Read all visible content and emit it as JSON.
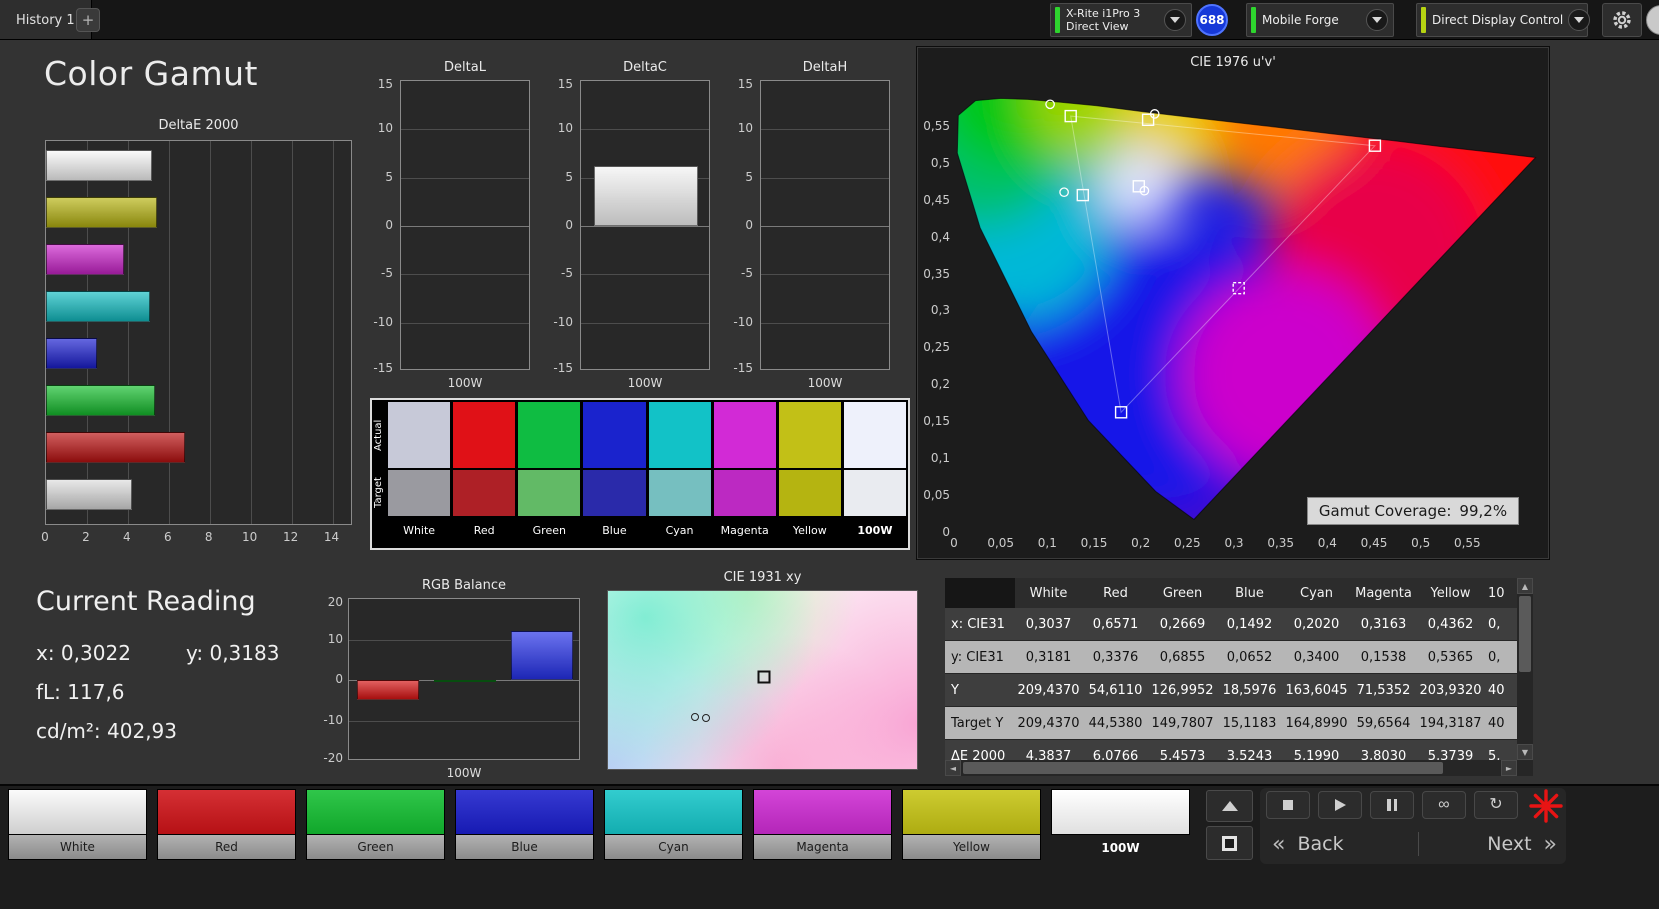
{
  "topbar": {
    "history_tab": "History 1",
    "add_tab": "+",
    "meter": {
      "name": "X-Rite i1Pro 3",
      "mode": "Direct View",
      "badge": "688"
    },
    "pattern_source": "Mobile Forge",
    "display_control": "Direct Display Control"
  },
  "page_title": "Color Gamut",
  "chart_data": [
    {
      "id": "delta_e_2000",
      "type": "bar",
      "title": "DeltaE 2000",
      "orientation": "horizontal",
      "categories": [
        "White",
        "Yellow",
        "Magenta",
        "Cyan",
        "Blue",
        "Green",
        "Red",
        "100W"
      ],
      "values": [
        5.2,
        5.4,
        3.8,
        5.1,
        2.5,
        5.3,
        6.8,
        4.2
      ],
      "bar_colors": [
        "#f8f8f8",
        "#b7b412",
        "#cb24cb",
        "#13bdc2",
        "#1b1fd0",
        "#16be2e",
        "#bb1212",
        "#dedede"
      ],
      "xlim": [
        0,
        15
      ],
      "xticks": [
        0,
        2,
        4,
        6,
        8,
        10,
        12,
        14
      ],
      "grid": true
    },
    {
      "id": "delta_l",
      "type": "bar",
      "title": "DeltaL",
      "categories": [
        "100W"
      ],
      "values": [
        0
      ],
      "ylim": [
        -15,
        15
      ],
      "yticks": [
        15,
        10,
        5,
        0,
        -5,
        -10,
        -15
      ],
      "xlabel": "100W"
    },
    {
      "id": "delta_c",
      "type": "bar",
      "title": "DeltaC",
      "categories": [
        "100W"
      ],
      "values": [
        6.2
      ],
      "bar_colors": [
        "#f2f2f2"
      ],
      "ylim": [
        -15,
        15
      ],
      "yticks": [
        15,
        10,
        5,
        0,
        -5,
        -10,
        -15
      ],
      "xlabel": "100W"
    },
    {
      "id": "delta_h",
      "type": "bar",
      "title": "DeltaH",
      "categories": [
        "100W"
      ],
      "values": [
        0
      ],
      "ylim": [
        -15,
        15
      ],
      "yticks": [
        15,
        10,
        5,
        0,
        -5,
        -10,
        -15
      ],
      "xlabel": "100W"
    },
    {
      "id": "rgb_balance",
      "type": "bar",
      "title": "RGB Balance",
      "categories": [
        "Red",
        "Green",
        "Blue"
      ],
      "values": [
        -5,
        -0.4,
        12
      ],
      "bar_colors": [
        "#d51414",
        "#11aa22",
        "#2531e8"
      ],
      "ylim": [
        -20,
        20
      ],
      "yticks": [
        20,
        10,
        0,
        -10,
        -20
      ],
      "xlabel": "100W"
    },
    {
      "id": "cie1976",
      "type": "scatter",
      "title": "CIE 1976 u'v'",
      "xlim": [
        0,
        0.63
      ],
      "ylim": [
        0,
        0.62
      ],
      "xticks": [
        "0",
        "0,05",
        "0,1",
        "0,15",
        "0,2",
        "0,25",
        "0,3",
        "0,35",
        "0,4",
        "0,45",
        "0,5",
        "0,55"
      ],
      "yticks": [
        "0",
        "0,05",
        "0,1",
        "0,15",
        "0,2",
        "0,25",
        "0,3",
        "0,35",
        "0,4",
        "0,45",
        "0,5",
        "0,55"
      ],
      "annotation": {
        "label": "Gamut Coverage:",
        "value": "99,2%"
      },
      "markers": [
        {
          "shape": "square",
          "u": 0.451,
          "v": 0.523,
          "name": "red-target"
        },
        {
          "shape": "square",
          "u": 0.125,
          "v": 0.563,
          "name": "green-target"
        },
        {
          "shape": "circle",
          "u": 0.103,
          "v": 0.579,
          "name": "green-measured"
        },
        {
          "shape": "square",
          "u": 0.208,
          "v": 0.558,
          "name": "yellow-target"
        },
        {
          "shape": "circle",
          "u": 0.215,
          "v": 0.566,
          "name": "yellow-measured"
        },
        {
          "shape": "square",
          "u": 0.138,
          "v": 0.456,
          "name": "cyan-target"
        },
        {
          "shape": "circle",
          "u": 0.118,
          "v": 0.46,
          "name": "cyan-measured"
        },
        {
          "shape": "square",
          "u": 0.198,
          "v": 0.468,
          "name": "white-target"
        },
        {
          "shape": "circle",
          "u": 0.204,
          "v": 0.462,
          "name": "white-measured"
        },
        {
          "shape": "square",
          "u": 0.305,
          "v": 0.33,
          "name": "magenta-target",
          "dashed": true
        },
        {
          "shape": "square",
          "u": 0.179,
          "v": 0.162,
          "name": "blue-target"
        }
      ]
    },
    {
      "id": "cie1931",
      "type": "scatter",
      "title": "CIE 1931 xy",
      "markers": [
        {
          "shape": "square",
          "fx": 0.5,
          "fy": 0.48,
          "name": "white-target"
        },
        {
          "shape": "circle",
          "fx": 0.28,
          "fy": 0.7,
          "name": "measured-1"
        },
        {
          "shape": "circle",
          "fx": 0.315,
          "fy": 0.705,
          "name": "measured-2"
        }
      ]
    }
  ],
  "swatch_panel": {
    "row_labels": [
      "Actual",
      "Target"
    ],
    "columns": [
      "White",
      "Red",
      "Green",
      "Blue",
      "Cyan",
      "Magenta",
      "Yellow",
      "100W"
    ],
    "actual_colors": [
      "#c7c9d8",
      "#e01117",
      "#0fbc42",
      "#1a23cd",
      "#12c2c7",
      "#d22ad6",
      "#c2c017",
      "#eef1fb"
    ],
    "target_colors": [
      "#9a9aa0",
      "#ae2026",
      "#62ba66",
      "#2a2aaa",
      "#76bfc0",
      "#bc29c2",
      "#b5b411",
      "#e9ebf0"
    ]
  },
  "current_reading": {
    "title": "Current Reading",
    "x": "x: 0,3022",
    "y": "y: 0,3183",
    "fl": "fL: 117,6",
    "cd": "cd/m²: 402,93"
  },
  "table": {
    "headers": [
      "",
      "White",
      "Red",
      "Green",
      "Blue",
      "Cyan",
      "Magenta",
      "Yellow",
      "10"
    ],
    "rows": [
      {
        "label": "x: CIE31",
        "values": [
          "0,3037",
          "0,6571",
          "0,2669",
          "0,1492",
          "0,2020",
          "0,3163",
          "0,4362",
          "0,"
        ],
        "highlight": false
      },
      {
        "label": "y: CIE31",
        "values": [
          "0,3181",
          "0,3376",
          "0,6855",
          "0,0652",
          "0,3400",
          "0,1538",
          "0,5365",
          "0,"
        ],
        "highlight": true
      },
      {
        "label": "Y",
        "values": [
          "209,4370",
          "54,6110",
          "126,9952",
          "18,5976",
          "163,6045",
          "71,5352",
          "203,9320",
          "40"
        ],
        "highlight": false
      },
      {
        "label": "Target Y",
        "values": [
          "209,4370",
          "44,5380",
          "149,7807",
          "15,1183",
          "164,8990",
          "59,6564",
          "194,3187",
          "40"
        ],
        "highlight": true
      },
      {
        "label": "ΔE 2000",
        "values": [
          "4,3837",
          "6,0766",
          "5,4573",
          "3,5243",
          "5,1990",
          "3,8030",
          "5,3739",
          "5,"
        ],
        "highlight": false
      }
    ]
  },
  "bottom_bar": {
    "patches": [
      {
        "label": "White",
        "color": "#e9e9e9",
        "gradient": true,
        "selected": false
      },
      {
        "label": "Red",
        "color": "#cf1318",
        "selected": false
      },
      {
        "label": "Green",
        "color": "#13be31",
        "selected": false
      },
      {
        "label": "Blue",
        "color": "#1a1ecb",
        "selected": false
      },
      {
        "label": "Cyan",
        "color": "#16c5c8",
        "selected": false
      },
      {
        "label": "Magenta",
        "color": "#cd2bd2",
        "selected": false
      },
      {
        "label": "Yellow",
        "color": "#c6c414",
        "selected": false
      },
      {
        "label": "100W",
        "color": "#ffffff",
        "selected": true
      }
    ],
    "transport": [
      {
        "name": "stop"
      },
      {
        "name": "play"
      },
      {
        "name": "pause"
      },
      {
        "name": "loop"
      },
      {
        "name": "refresh"
      }
    ],
    "back": "Back",
    "next": "Next",
    "back_chevron": "«",
    "next_chevron": "»"
  },
  "colors": {
    "accent_green": "#2ed52e",
    "accent_yellow_green": "#b6d312",
    "badge_blue": "#1638d8",
    "asterisk_red": "#e81414"
  }
}
